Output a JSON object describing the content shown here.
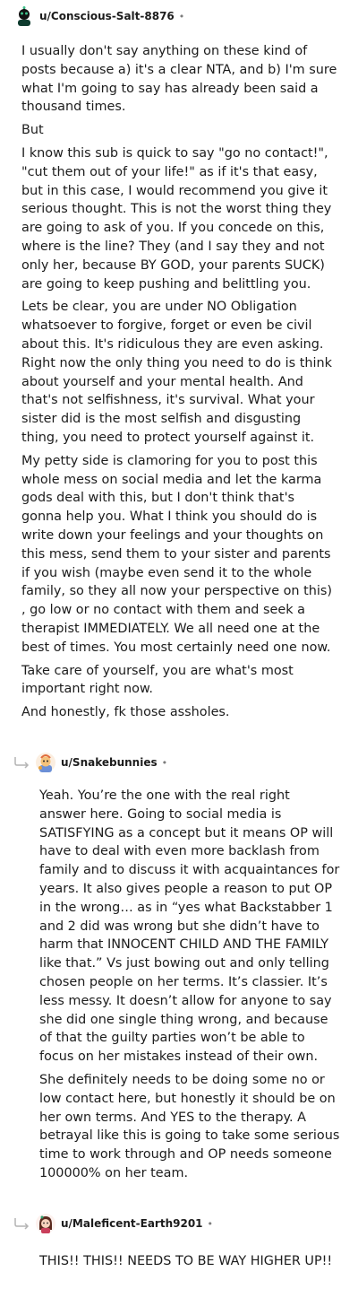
{
  "comments": [
    {
      "username": "u/Conscious-Salt-8876",
      "separator": "•",
      "avatar_icon": "snoo-avatar-icon",
      "paragraphs": [
        "I usually don't say anything on these kind of posts because a) it's a clear NTA, and b) I'm sure what I'm going to say has already been said a thousand times.",
        "But",
        "I know this sub is quick to say \"go no contact!\", \"cut them out of your life!\" as if it's that easy, but in this case, I would recommend you give it serious thought. This is not the worst thing they are going to ask of you. If you concede on this, where is the line? They (and I say they and not only her, because BY GOD, your parents SUCK) are going to keep pushing and belittling you.",
        "Lets be clear, you are under NO Obligation whatsoever to forgive, forget or even be civil about this. It's ridiculous they are even asking. Right now the only thing you need to do is think about yourself and your mental health. And that's not selfishness, it's survival. What your sister did is the most selfish and disgusting thing, you need to protect yourself against it.",
        "My petty side is clamoring for you to post this whole mess on social media and let the karma gods deal with this, but I don't think that's gonna help you. What I think you should do is write down your feelings and your thoughts on this mess, send them to your sister and parents if you wish (maybe even send it to the whole family, so they all now your perspective on this) , go low or no contact with them and seek a therapist IMMEDIATELY. We all need one at the best of times. You most certainly need one now.",
        "Take care of yourself, you are what's most important right now.",
        "And honestly, fk those assholes."
      ]
    },
    {
      "username": "u/Snakebunnies",
      "separator": "•",
      "avatar_icon": "snoo-avatar-icon",
      "reply_icon": "reply-arrow-icon",
      "paragraphs": [
        "Yeah. You’re the one with the real right answer here. Going to social media is SATISFYING as a concept but it means OP will have to deal with even more backlash from family and to discuss it with acquaintances for years. It also gives people a reason to put OP in the wrong… as in “yes what Backstabber 1 and 2 did was wrong but she didn’t have to harm that INNOCENT CHILD AND THE FAMILY like that.” Vs just bowing out and only telling chosen people on her terms. It’s classier. It’s less messy. It doesn’t allow for anyone to say she did one single thing wrong, and because of that the guilty parties won’t be able to focus on her mistakes instead of their own.",
        "She definitely needs to be doing some no or low contact here, but honestly it should be on her own terms. And YES to the therapy. A betrayal like this is going to take some serious time to work through and OP needs someone 100000% on her team."
      ]
    },
    {
      "username": "u/Maleficent-Earth9201",
      "separator": "•",
      "avatar_icon": "snoo-avatar-icon",
      "reply_icon": "reply-arrow-icon",
      "paragraphs": [
        "THIS!! THIS!! NEEDS TO BE WAY HIGHER UP!!"
      ]
    }
  ]
}
